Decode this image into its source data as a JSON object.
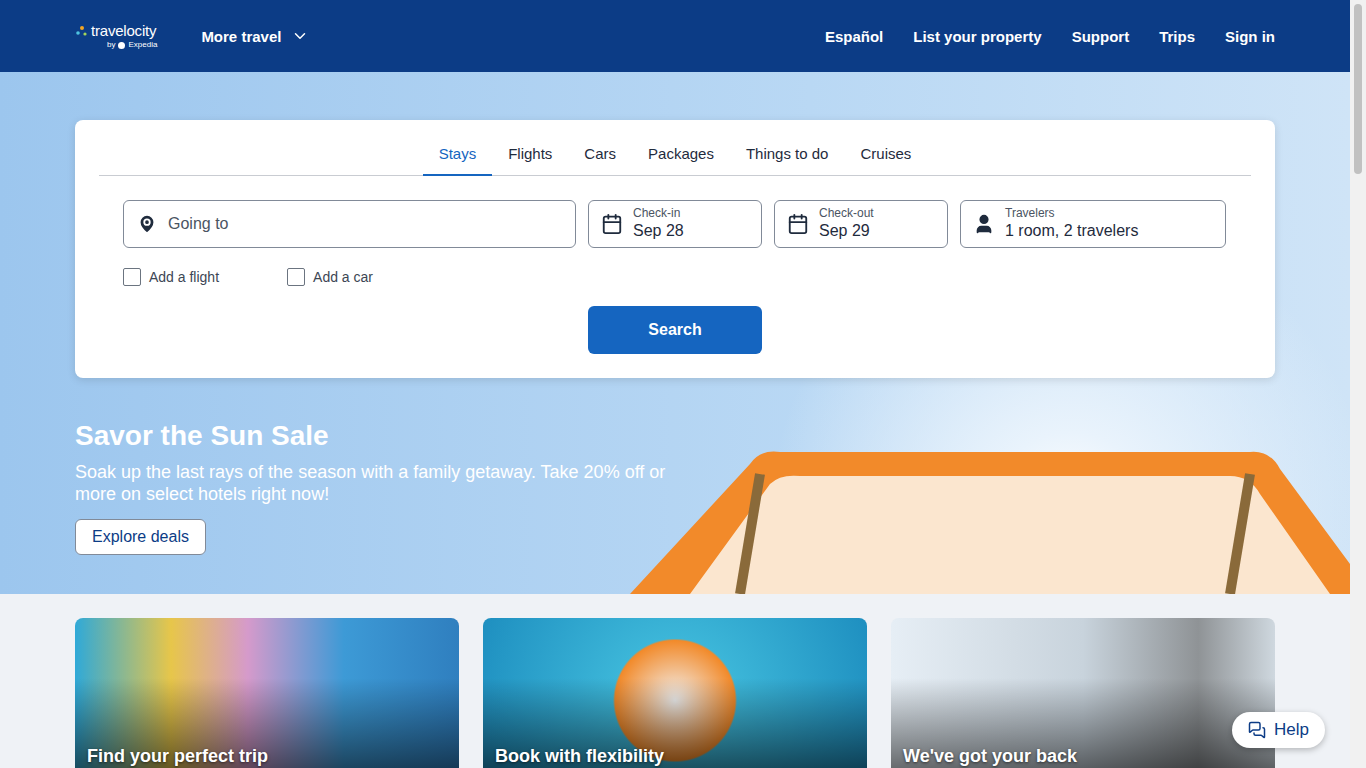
{
  "header": {
    "logo": {
      "name": "travelocity",
      "byline": "by",
      "partner": "Expedia"
    },
    "menu": "More travel",
    "links": [
      "Español",
      "List your property",
      "Support",
      "Trips",
      "Sign in"
    ]
  },
  "search": {
    "tabs": [
      {
        "label": "Stays",
        "selected": true
      },
      {
        "label": "Flights",
        "selected": false
      },
      {
        "label": "Cars",
        "selected": false
      },
      {
        "label": "Packages",
        "selected": false
      },
      {
        "label": "Things to do",
        "selected": false
      },
      {
        "label": "Cruises",
        "selected": false
      }
    ],
    "destination": {
      "placeholder": "Going to"
    },
    "dates": [
      {
        "label": "Check-in",
        "value": "Sep 28"
      },
      {
        "label": "Check-out",
        "value": "Sep 29"
      }
    ],
    "travelers": {
      "label": "Travelers",
      "value": "1 room, 2 travelers"
    },
    "options": [
      {
        "label": "Add a flight",
        "checked": false
      },
      {
        "label": "Add a car",
        "checked": false
      }
    ],
    "button": "Search"
  },
  "promo": {
    "title": "Savor the Sun Sale",
    "text": "Soak up the last rays of the season with a family getaway. Take 20% off or more on select hotels right now!",
    "button": "Explore deals"
  },
  "cards": [
    {
      "caption": "Find your perfect trip"
    },
    {
      "caption": "Book with flexibility"
    },
    {
      "caption": "We've got your back"
    }
  ],
  "help": "Help"
}
